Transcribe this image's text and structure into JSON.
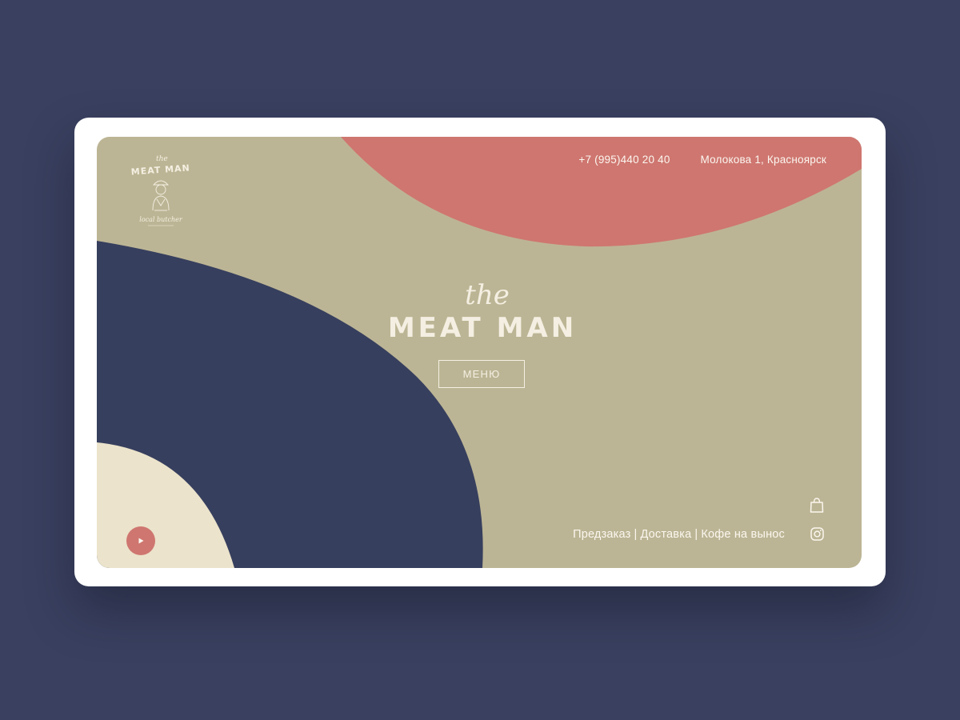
{
  "colors": {
    "page_bg": "#3a4060",
    "khaki": "#bcb595",
    "salmon": "#cf7670",
    "navy": "#373f5e",
    "cream": "#ebe3cb",
    "light_text": "#f4efe2"
  },
  "logo": {
    "the": "the",
    "name": "MEAT MAN",
    "tagline": "local butcher",
    "icon": "butcher-illustration"
  },
  "header": {
    "phone": "+7 (995)440 20 40",
    "address": "Молокова 1, Красноярск"
  },
  "hero": {
    "the": "the",
    "title": "MEAT MAN",
    "menu_button": "МЕНЮ"
  },
  "footer_nav": {
    "items": [
      "Предзаказ",
      "Доставка",
      "Кофе на вынос"
    ],
    "separator": "|"
  },
  "icons": {
    "cart": "shopping-bag-icon",
    "social": "instagram-icon",
    "play": "play-icon"
  }
}
